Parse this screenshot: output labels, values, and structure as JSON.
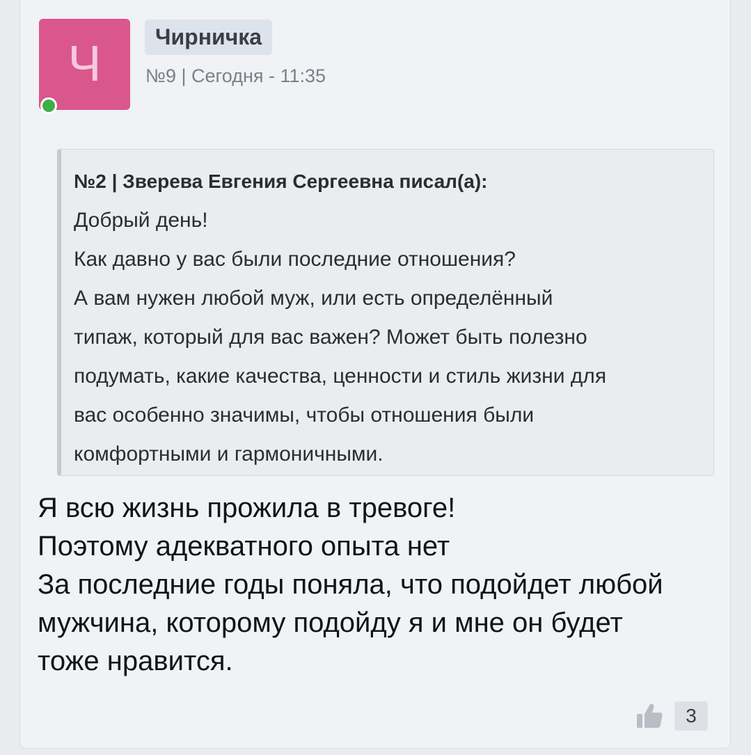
{
  "post": {
    "avatar_letter": "Ч",
    "avatar_color": "#d9578d",
    "online_status_color": "#3fae49",
    "author": "Чирничка",
    "meta": "№9 | Сегодня - 11:35",
    "quote": {
      "header": "№2 | Зверева Евгения Сергеевна писал(а):",
      "lines": [
        "Добрый день!",
        "Как давно у вас были последние отношения?",
        "А вам нужен любой муж, или есть определённый",
        "типаж, который для вас важен? Может быть полезно",
        "подумать, какие качества, ценности и стиль жизни для",
        "вас особенно значимы, чтобы отношения были",
        "комфортными и гармоничными."
      ]
    },
    "message_lines": [
      "Я всю жизнь прожила в тревоге!",
      "Поэтому адекватного опыта нет",
      "За последние годы поняла, что подойдет любой",
      "мужчина, которому подойду я и мне он будет",
      "тоже нравится."
    ],
    "likes": {
      "icon": "thumbs-up-icon",
      "count": "3"
    }
  }
}
